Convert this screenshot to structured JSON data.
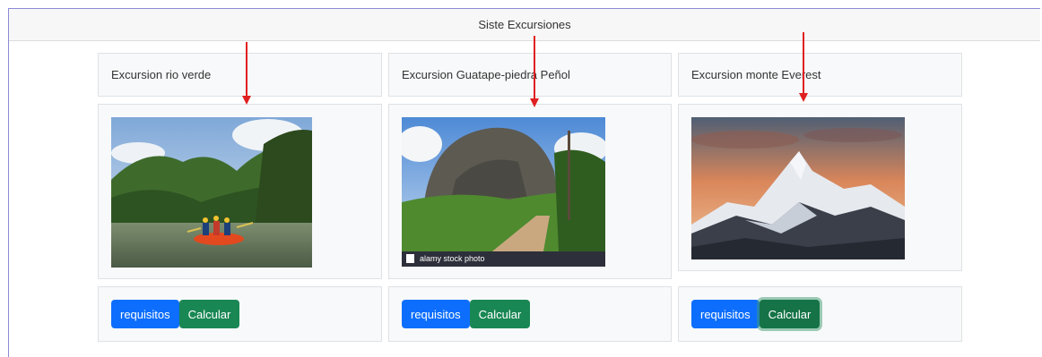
{
  "header": {
    "title": "Siste Excursiones"
  },
  "excursions": [
    {
      "title": "Excursion rio verde",
      "image_icon": "rafting-river-photo",
      "btn_requisitos": "requisitos",
      "btn_calcular": "Calcular"
    },
    {
      "title": "Excursion Guatape-piedra Peñol",
      "image_icon": "rock-road-photo",
      "watermark": "alamy stock photo",
      "btn_requisitos": "requisitos",
      "btn_calcular": "Calcular"
    },
    {
      "title": "Excursion monte Everest",
      "image_icon": "mountain-sunset-photo",
      "btn_requisitos": "requisitos",
      "btn_calcular": "Calcular"
    }
  ],
  "colors": {
    "primary": "#0d6efd",
    "success": "#198754",
    "annotation_arrow": "#e02020"
  }
}
